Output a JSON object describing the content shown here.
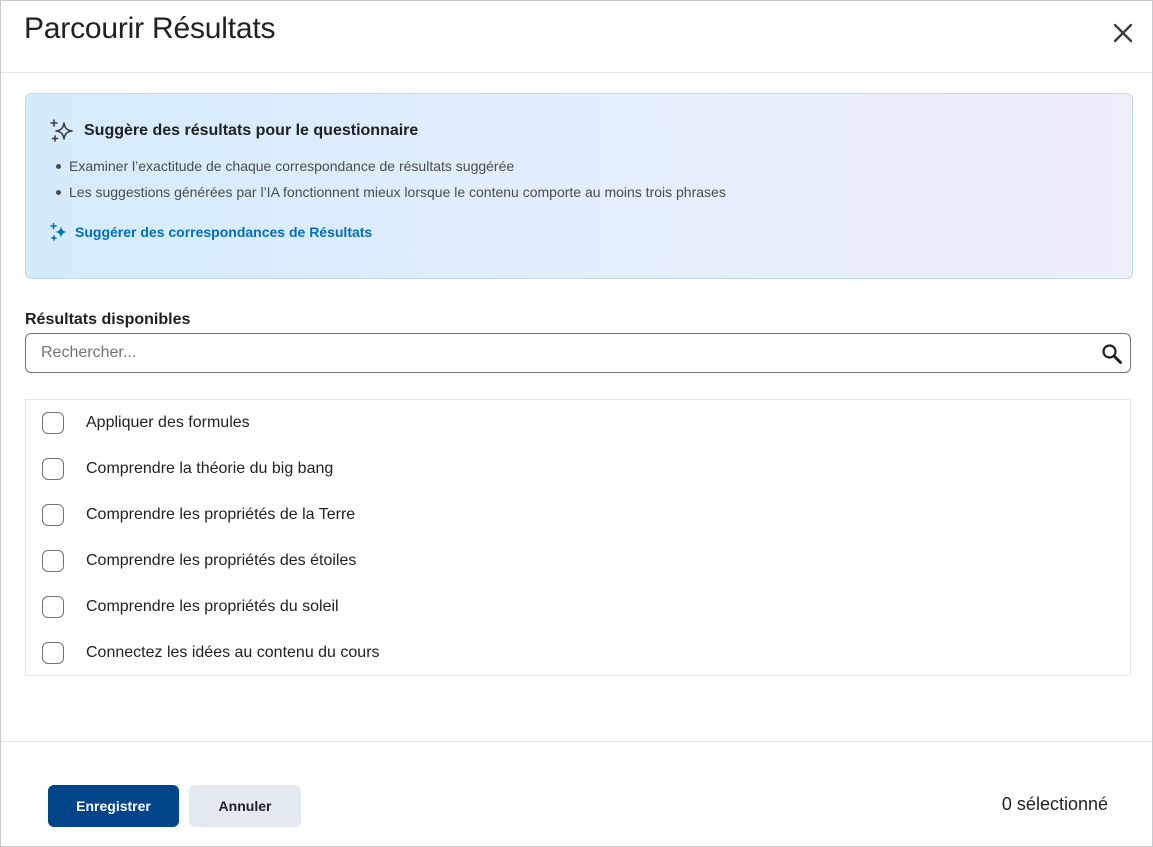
{
  "dialog": {
    "title": "Parcourir Résultats",
    "close_icon": "close-icon"
  },
  "suggestions": {
    "heading": "Suggère des résultats pour le questionnaire",
    "heading_icon": "sparkles-icon",
    "bullets": [
      "Examiner l’exactitude de chaque correspondance de résultats suggérée",
      "Les suggestions générées par l’IA fonctionnent mieux lorsque le contenu comporte au moins trois phrases"
    ],
    "action_label": "Suggérer des correspondances de Résultats",
    "action_icon": "sparkles-icon"
  },
  "available": {
    "label": "Résultats disponibles",
    "search_placeholder": "Rechercher...",
    "search_value": "",
    "search_icon": "search-icon",
    "items": [
      {
        "label": "Appliquer des formules",
        "checked": false
      },
      {
        "label": "Comprendre la théorie du big bang",
        "checked": false
      },
      {
        "label": "Comprendre les propriétés de la Terre",
        "checked": false
      },
      {
        "label": "Comprendre les propriétés des étoiles",
        "checked": false
      },
      {
        "label": "Comprendre les propriétés du soleil",
        "checked": false
      },
      {
        "label": "Connectez les idées au contenu du cours",
        "checked": false
      }
    ]
  },
  "footer": {
    "save_label": "Enregistrer",
    "cancel_label": "Annuler",
    "selected_count": "0 sélectionné"
  },
  "colors": {
    "primary": "#004489",
    "link": "#006fbf",
    "secondary_bg": "#e3e9f1"
  }
}
